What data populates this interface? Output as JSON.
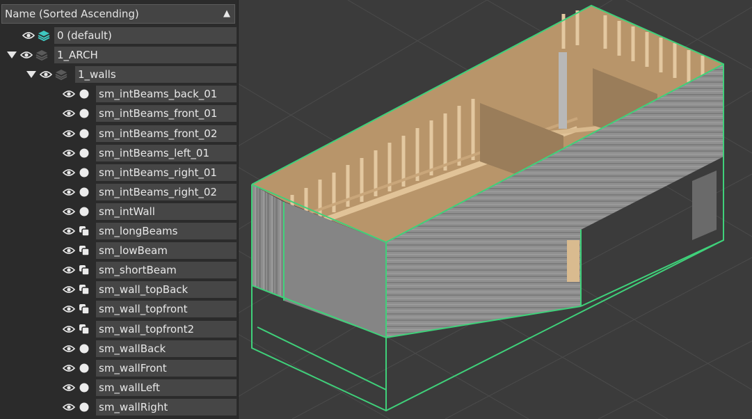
{
  "header": {
    "label": "Name (Sorted Ascending)"
  },
  "rows": [
    {
      "label": "0 (default)",
      "icon": "layer-stack-active-icon",
      "expanded": null
    },
    {
      "label": "1_ARCH",
      "icon": "layer-stack-icon",
      "expanded": true
    },
    {
      "label": "1_walls",
      "icon": "layer-stack-icon",
      "expanded": true
    },
    {
      "label": "sm_intBeams_back_01",
      "icon": "object-sphere-icon"
    },
    {
      "label": "sm_intBeams_front_01",
      "icon": "object-sphere-icon"
    },
    {
      "label": "sm_intBeams_front_02",
      "icon": "object-sphere-icon"
    },
    {
      "label": "sm_intBeams_left_01",
      "icon": "object-sphere-icon"
    },
    {
      "label": "sm_intBeams_right_01",
      "icon": "object-sphere-icon"
    },
    {
      "label": "sm_intBeams_right_02",
      "icon": "object-sphere-icon"
    },
    {
      "label": "sm_intWall",
      "icon": "object-sphere-icon"
    },
    {
      "label": "sm_longBeams",
      "icon": "editable-poly-icon"
    },
    {
      "label": "sm_lowBeam",
      "icon": "editable-poly-icon"
    },
    {
      "label": "sm_shortBeam",
      "icon": "editable-poly-icon"
    },
    {
      "label": "sm_wall_topBack",
      "icon": "editable-poly-icon"
    },
    {
      "label": "sm_wall_topfront",
      "icon": "editable-poly-icon"
    },
    {
      "label": "sm_wall_topfront2",
      "icon": "editable-poly-icon"
    },
    {
      "label": "sm_wallBack",
      "icon": "object-sphere-icon"
    },
    {
      "label": "sm_wallFront",
      "icon": "object-sphere-icon"
    },
    {
      "label": "sm_wallLeft",
      "icon": "object-sphere-icon"
    },
    {
      "label": "sm_wallRight",
      "icon": "object-sphere-icon"
    }
  ],
  "colors": {
    "selection_outline": "#3fd17a",
    "wood_light": "#c9a67a",
    "wall_grey": "#8a8a8a",
    "grid": "#4a4a4a"
  }
}
